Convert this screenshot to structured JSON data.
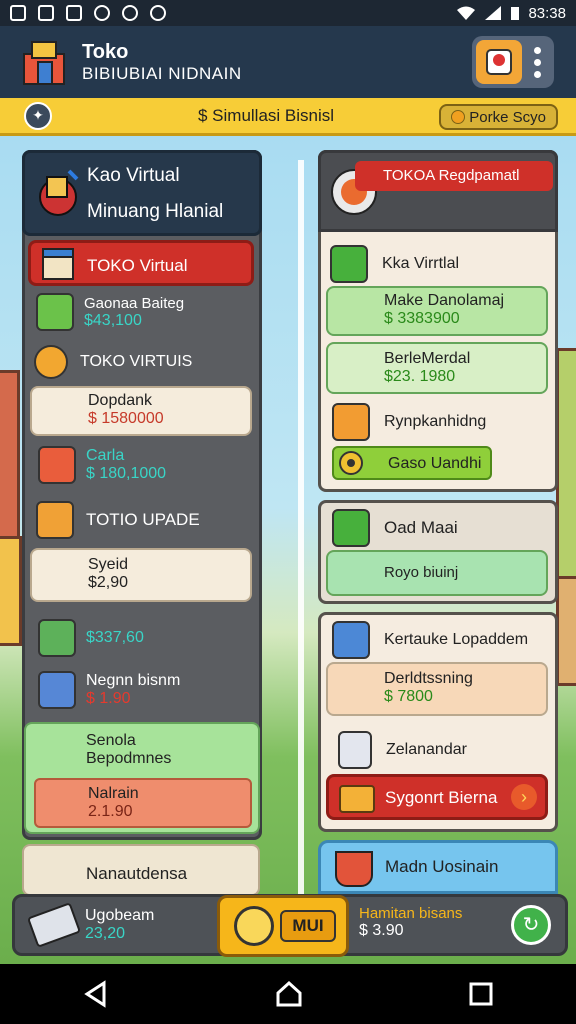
{
  "status_bar": {
    "time": "83:38"
  },
  "header": {
    "title": "Toko",
    "subtitle": "BIBIUBIAI NIDNAIN"
  },
  "banner": {
    "text": "$ Simullasi Bisnisl",
    "pill": "Porke Scyo"
  },
  "left_panel": {
    "title": "Kao Virtual",
    "subtitle": "Minuang Hlanial",
    "section1_title": "TOKO Virtual",
    "item1": {
      "label": "Gaonaa Baiteg",
      "value": "$43,100"
    },
    "section2_title": "TOKO VIRTUIS",
    "item2": {
      "label": "Dopdank",
      "value": "$ 1580000"
    },
    "item3": {
      "label": "Carla",
      "value": "$ 180,1000"
    },
    "section3_title": "TOTIO UPADE",
    "item4": {
      "label": "Syeid",
      "value": "$2,90"
    },
    "item5": {
      "value": "$337,60"
    },
    "item6": {
      "label": "Negnn bisnm",
      "value": "$ 1.90"
    },
    "item7": {
      "label": "Senola",
      "label2": "Bepodmnes"
    },
    "item8": {
      "label": "Nalrain",
      "value": "2.1.90"
    },
    "item9": {
      "label": "Nanautdensa"
    }
  },
  "right_panel": {
    "title": "TOKOA Regdpamatl",
    "item1": {
      "label": "Kka Virrtlal"
    },
    "item2": {
      "label": "Make Danolamaj",
      "value": "$ 3383900"
    },
    "item3": {
      "label": "BerleMerdal",
      "value": "$23. 1980"
    },
    "item4": {
      "label": "Rynpkanhidng"
    },
    "button1": "Gaso Uandhi",
    "item5": {
      "label": "Oad Maai"
    },
    "item6": {
      "label": "Royo biuinj"
    },
    "item7": {
      "label": "Kertauke Lopaddem"
    },
    "item8": {
      "label": "Derldtssning",
      "value": "$ 7800"
    },
    "item9": {
      "label": "Zelanandar"
    },
    "button2": "Sygonrt Bierna",
    "item10": {
      "label": "Madn Uosinain"
    }
  },
  "bottom_bar": {
    "left_label": "Ugobeam",
    "left_value": "23,20",
    "center_button": "MUI",
    "right_label": "Hamitan bisans",
    "right_value": "$ 3.90"
  }
}
